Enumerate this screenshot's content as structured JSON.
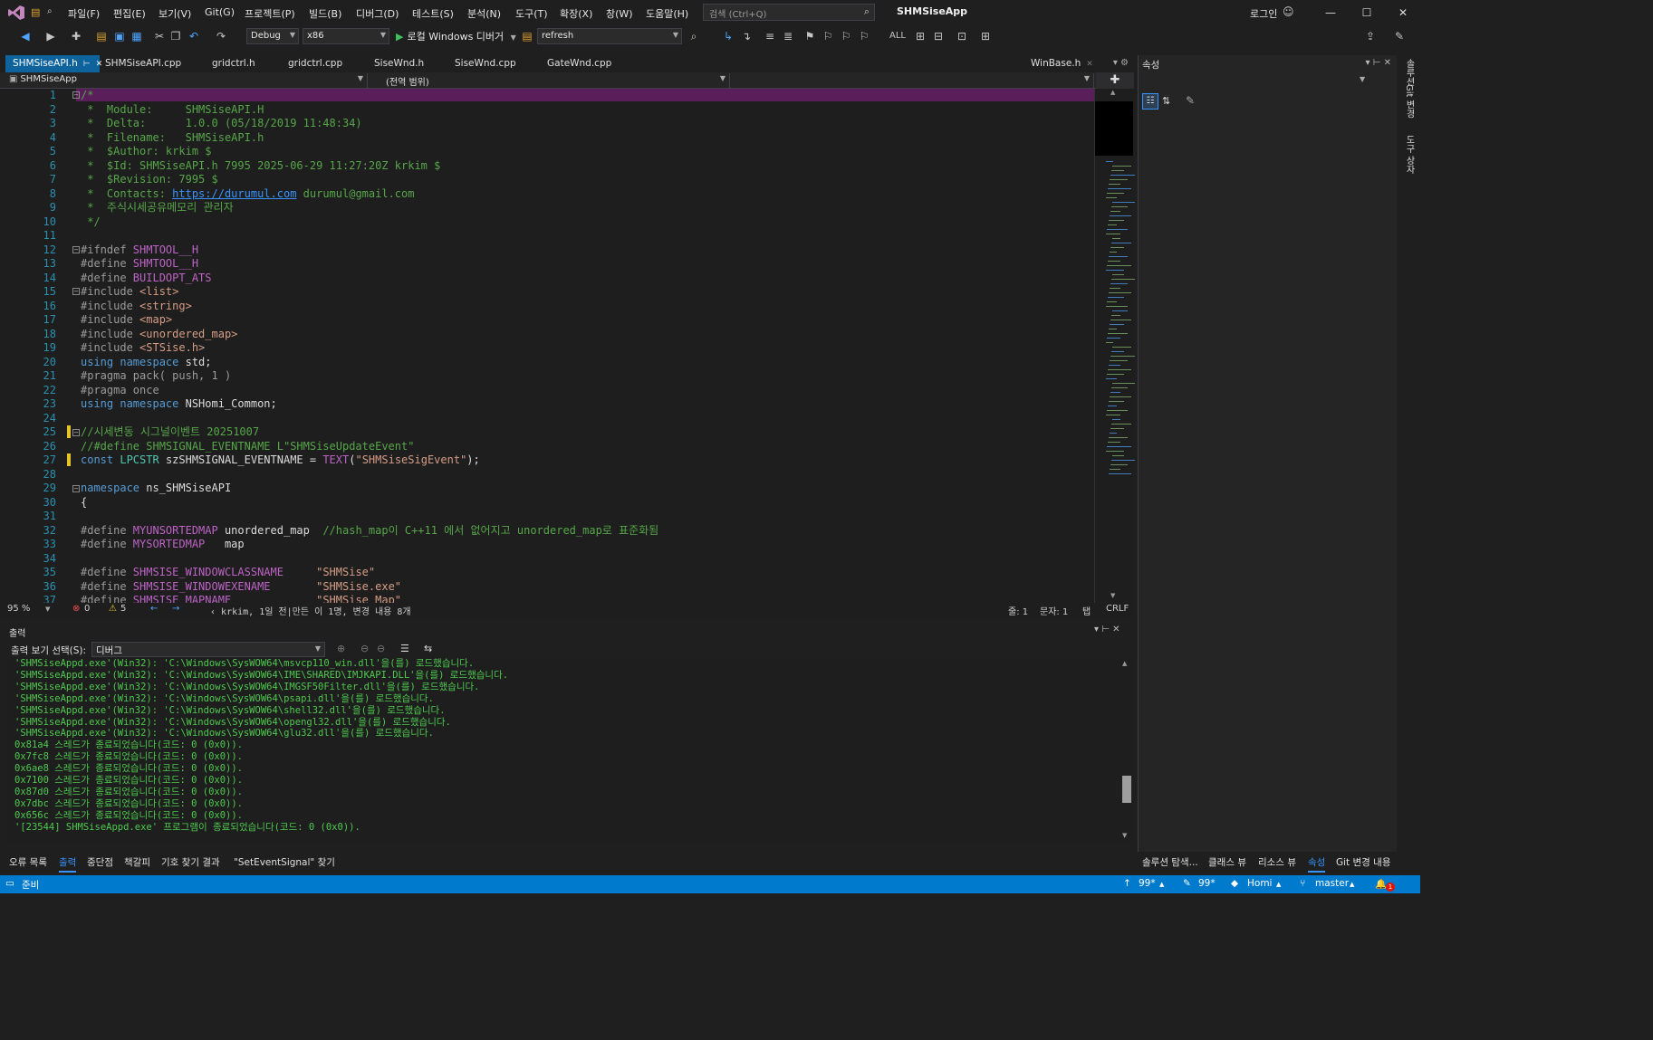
{
  "menu": {
    "items": [
      "파일(F)",
      "편집(E)",
      "보기(V)",
      "Git(G)",
      "프로젝트(P)",
      "빌드(B)",
      "디버그(D)",
      "테스트(S)",
      "분석(N)",
      "도구(T)",
      "확장(X)",
      "창(W)",
      "도움말(H)"
    ],
    "search_placeholder": "검색 (Ctrl+Q)",
    "app_title": "SHMSiseApp",
    "login": "로그인"
  },
  "toolbar": {
    "config": "Debug",
    "platform": "x86",
    "run_label": "로컬 Windows 디버거",
    "find_value": "refresh",
    "all_label": "ALL"
  },
  "tabs": {
    "items": [
      "SHMSiseAPI.h",
      "SHMSiseAPI.cpp",
      "gridctrl.h",
      "gridctrl.cpp",
      "SiseWnd.h",
      "SiseWnd.cpp",
      "GateWnd.cpp"
    ],
    "overflow": "WinBase.h"
  },
  "navbar": {
    "project": "SHMSiseApp",
    "scope": "(전역 범위)"
  },
  "editor": {
    "lines": [
      [
        [
          "cm",
          "/*"
        ]
      ],
      [
        [
          "cm",
          " *  Module:     SHMSiseAPI.H"
        ]
      ],
      [
        [
          "cm",
          " *  Delta:      1.0.0 (05/18/2019 11:48:34)"
        ]
      ],
      [
        [
          "cm",
          " *  Filename:   SHMSiseAPI.h"
        ]
      ],
      [
        [
          "cm",
          " *  $Author: krkim $"
        ]
      ],
      [
        [
          "cm",
          " *  $Id: SHMSiseAPI.h 7995 2025-06-29 11:27:20Z krkim $"
        ]
      ],
      [
        [
          "cm",
          " *  $Revision: 7995 $"
        ]
      ],
      [
        [
          "cm",
          " *  Contacts: "
        ],
        [
          "lnk",
          "https://durumul.com"
        ],
        [
          "cm",
          " durumul@gmail.com"
        ]
      ],
      [
        [
          "cm",
          " *  주식시세공유메모리 관리자"
        ]
      ],
      [
        [
          "cm",
          " */"
        ]
      ],
      [
        [
          "",
          ""
        ]
      ],
      [
        [
          "pp",
          "#ifndef "
        ],
        [
          "mac",
          "SHMTOOL__H"
        ]
      ],
      [
        [
          "pp",
          "#define "
        ],
        [
          "mac",
          "SHMTOOL__H"
        ]
      ],
      [
        [
          "pp",
          "#define "
        ],
        [
          "mac",
          "BUILDOPT_ATS"
        ]
      ],
      [
        [
          "pp",
          "#include "
        ],
        [
          "str",
          "<list>"
        ]
      ],
      [
        [
          "pp",
          "#include "
        ],
        [
          "str",
          "<string>"
        ]
      ],
      [
        [
          "pp",
          "#include "
        ],
        [
          "str",
          "<map>"
        ]
      ],
      [
        [
          "pp",
          "#include "
        ],
        [
          "str",
          "<unordered_map>"
        ]
      ],
      [
        [
          "pp",
          "#include "
        ],
        [
          "str",
          "<STSise.h>"
        ]
      ],
      [
        [
          "kw",
          "using namespace "
        ],
        [
          "",
          "std;"
        ]
      ],
      [
        [
          "pp",
          "#pragma pack( push, 1 )"
        ]
      ],
      [
        [
          "pp",
          "#pragma once"
        ]
      ],
      [
        [
          "kw",
          "using namespace "
        ],
        [
          "",
          "NSHomi_Common;"
        ]
      ],
      [
        [
          "",
          ""
        ]
      ],
      [
        [
          "cm",
          "//시세변동 시그널이벤트 20251007"
        ]
      ],
      [
        [
          "cm",
          "//#define SHMSIGNAL_EVENTNAME L\"SHMSiseUpdateEvent\""
        ]
      ],
      [
        [
          "kw",
          "const "
        ],
        [
          "ty",
          "LPCSTR "
        ],
        [
          "",
          "szSHMSIGNAL_EVENTNAME = "
        ],
        [
          "mac",
          "TEXT"
        ],
        [
          "",
          "("
        ],
        [
          "str",
          "\"SHMSiseSigEvent\""
        ],
        [
          "",
          ");"
        ]
      ],
      [
        [
          "",
          ""
        ]
      ],
      [
        [
          "kw",
          "namespace "
        ],
        [
          "",
          "ns_SHMSiseAPI"
        ]
      ],
      [
        [
          "",
          "{"
        ]
      ],
      [
        [
          "",
          ""
        ]
      ],
      [
        [
          "pp",
          "#define "
        ],
        [
          "mac",
          "MYUNSORTEDMAP "
        ],
        [
          "",
          "unordered_map  "
        ],
        [
          "cm",
          "//hash_map이 C++11 에서 없어지고 unordered_map로 표준화됨"
        ]
      ],
      [
        [
          "pp",
          "#define "
        ],
        [
          "mac",
          "MYSORTEDMAP   "
        ],
        [
          "",
          "map"
        ]
      ],
      [
        [
          "",
          ""
        ]
      ],
      [
        [
          "pp",
          "#define "
        ],
        [
          "mac",
          "SHMSISE_WINDOWCLASSNAME     "
        ],
        [
          "str",
          "\"SHMSise\""
        ]
      ],
      [
        [
          "pp",
          "#define "
        ],
        [
          "mac",
          "SHMSISE_WINDOWEXENAME       "
        ],
        [
          "str",
          "\"SHMSise.exe\""
        ]
      ],
      [
        [
          "pp",
          "#define "
        ],
        [
          "mac",
          "SHMSISE_MAPNAME             "
        ],
        [
          "str",
          "\"SHMSise_Map\""
        ]
      ]
    ]
  },
  "editor_status": {
    "zoom": "95 %",
    "errors": "0",
    "warnings": "5",
    "blame": "krkim, 1일 전|만든 이 1명, 변경 내용 8개",
    "line": "줄: 1",
    "char": "문자: 1",
    "tab": "탭",
    "eol": "CRLF"
  },
  "output": {
    "title": "출력",
    "select_label": "출력 보기 선택(S):",
    "select_value": "디버그",
    "lines": [
      "'SHMSiseAppd.exe'(Win32): 'C:\\Windows\\SysWOW64\\msvcp110_win.dll'을(를) 로드했습니다.",
      "'SHMSiseAppd.exe'(Win32): 'C:\\Windows\\SysWOW64\\IME\\SHARED\\IMJKAPI.DLL'을(를) 로드했습니다.",
      "'SHMSiseAppd.exe'(Win32): 'C:\\Windows\\SysWOW64\\IMGSF50Filter.dll'을(를) 로드했습니다.",
      "'SHMSiseAppd.exe'(Win32): 'C:\\Windows\\SysWOW64\\psapi.dll'을(를) 로드했습니다.",
      "'SHMSiseAppd.exe'(Win32): 'C:\\Windows\\SysWOW64\\shell32.dll'을(를) 로드했습니다.",
      "'SHMSiseAppd.exe'(Win32): 'C:\\Windows\\SysWOW64\\opengl32.dll'을(를) 로드했습니다.",
      "'SHMSiseAppd.exe'(Win32): 'C:\\Windows\\SysWOW64\\glu32.dll'을(를) 로드했습니다.",
      "0x81a4 스레드가 종료되었습니다(코드: 0 (0x0)).",
      "0x7fc8 스레드가 종료되었습니다(코드: 0 (0x0)).",
      "0x6ae8 스레드가 종료되었습니다(코드: 0 (0x0)).",
      "0x7100 스레드가 종료되었습니다(코드: 0 (0x0)).",
      "0x87d0 스레드가 종료되었습니다(코드: 0 (0x0)).",
      "0x7dbc 스레드가 종료되었습니다(코드: 0 (0x0)).",
      "0x656c 스레드가 종료되었습니다(코드: 0 (0x0)).",
      "'[23544] SHMSiseAppd.exe' 프로그램이 종료되었습니다(코드: 0 (0x0))."
    ]
  },
  "bottom_tabs": [
    "오류 목록",
    "출력",
    "중단점",
    "책갈피",
    "기호 찾기 결과",
    "\"SetEventSignal\" 찾기"
  ],
  "right_tabs": [
    "솔루션 탐색...",
    "클래스 뷰",
    "리소스 뷰",
    "속성",
    "Git 변경 내용"
  ],
  "properties": {
    "title": "속성"
  },
  "side_strip": [
    "솔루션",
    "Git 변경",
    "도구 상자"
  ],
  "statusbar": {
    "ready": "준비",
    "up_count": "99*",
    "edit_count": "99*",
    "repo": "Homi",
    "branch": "master",
    "notify": "1"
  },
  "colors": {
    "accent": "#007acc",
    "tab_active": "#0e639c",
    "comment": "#57a64a",
    "keyword": "#569cd6",
    "macro": "#bd63c5",
    "string": "#d69d85",
    "output_text": "#4ec94e"
  }
}
